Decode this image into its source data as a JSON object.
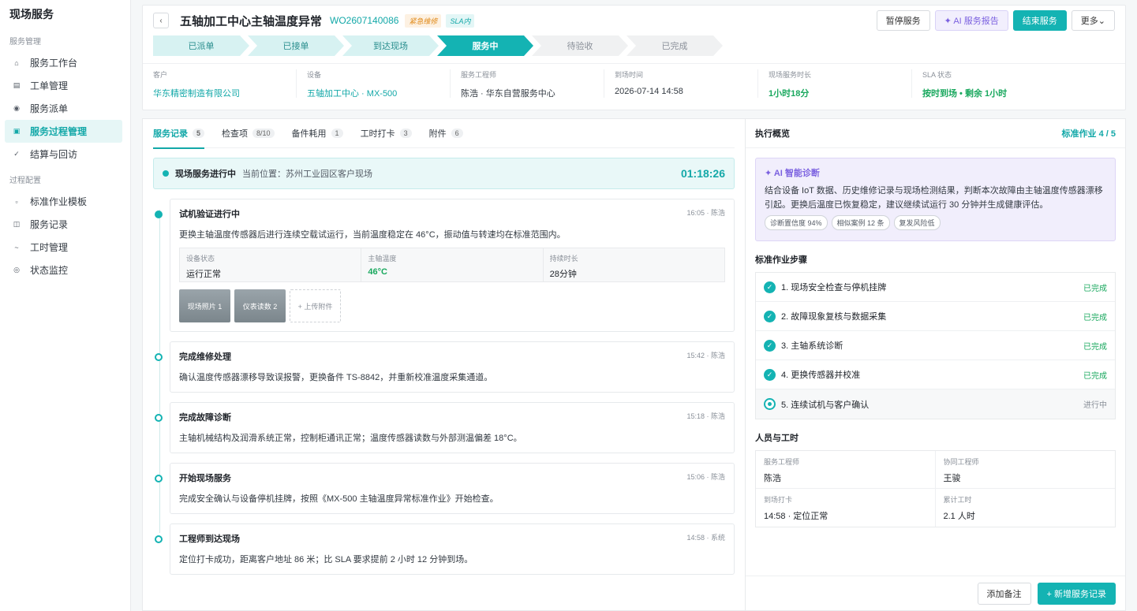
{
  "app_title": "现场服务",
  "sidebar": {
    "group1": "服务管理",
    "items1": [
      {
        "label": "服务工作台",
        "icon": "home-icon",
        "glyph": "⌂"
      },
      {
        "label": "工单管理",
        "icon": "list-icon",
        "glyph": "▤"
      },
      {
        "label": "服务派单",
        "icon": "dispatch-icon",
        "glyph": "◉"
      },
      {
        "label": "服务过程管理",
        "icon": "process-icon",
        "glyph": "▣"
      },
      {
        "label": "结算与回访",
        "icon": "check-icon",
        "glyph": "✓"
      }
    ],
    "group2": "过程配置",
    "items2": [
      {
        "label": "标准作业模板",
        "icon": "template-icon",
        "glyph": "▫"
      },
      {
        "label": "服务记录",
        "icon": "record-icon",
        "glyph": "◫"
      },
      {
        "label": "工时管理",
        "icon": "time-icon",
        "glyph": "~"
      },
      {
        "label": "状态监控",
        "icon": "monitor-icon",
        "glyph": "◎"
      }
    ]
  },
  "header": {
    "back": "‹",
    "title": "五轴加工中心主轴温度异常",
    "wo_no": "WO2607140086",
    "tag_urgent": "紧急维修",
    "tag_sla": "SLA内",
    "btn_pause": "暂停服务",
    "btn_ai": "✦ AI 服务报告",
    "btn_end": "结束服务",
    "btn_more": "更多⌄"
  },
  "steps": [
    "已派单",
    "已接单",
    "到达现场",
    "服务中",
    "待验收",
    "已完成"
  ],
  "infos": [
    {
      "label": "客户",
      "value": "华东精密制造有限公司"
    },
    {
      "label": "设备",
      "value": "五轴加工中心 · MX-500"
    },
    {
      "label": "服务工程师",
      "value": "陈浩 · 华东自营服务中心"
    },
    {
      "label": "到场时间",
      "value": "2026-07-14 14:58"
    },
    {
      "label": "现场服务时长",
      "value": "1小时18分"
    },
    {
      "label": "SLA 状态",
      "value": "按时到场 • 剩余 1小时"
    }
  ],
  "tabs": [
    {
      "label": "服务记录",
      "count": "5"
    },
    {
      "label": "检查项",
      "count": "8/10"
    },
    {
      "label": "备件耗用",
      "count": "1"
    },
    {
      "label": "工时打卡",
      "count": "3"
    },
    {
      "label": "附件",
      "count": "6"
    }
  ],
  "live": {
    "title": "现场服务进行中",
    "location": "当前位置：苏州工业园区客户现场",
    "timer": "01:18:26"
  },
  "timeline": [
    {
      "title": "试机验证进行中",
      "meta": "16:05 · 陈浩",
      "desc": "更换主轴温度传感器后进行连续空载试运行，当前温度稳定在 46°C，振动值与转速均在标准范围内。",
      "grid": [
        {
          "label": "设备状态",
          "value": "运行正常"
        },
        {
          "label": "主轴温度",
          "value": "46°C"
        },
        {
          "label": "持续时长",
          "value": "28分钟"
        }
      ],
      "thumbs": [
        "现场照片 1",
        "仪表读数 2",
        "+ 上传附件"
      ]
    },
    {
      "title": "完成维修处理",
      "meta": "15:42 · 陈浩",
      "desc": "确认温度传感器漂移导致误报警，更换备件 TS-8842，并重新校准温度采集通道。"
    },
    {
      "title": "完成故障诊断",
      "meta": "15:18 · 陈浩",
      "desc": "主轴机械结构及润滑系统正常，控制柜通讯正常；温度传感器读数与外部测温偏差 18°C。"
    },
    {
      "title": "开始现场服务",
      "meta": "15:06 · 陈浩",
      "desc": "完成安全确认与设备停机挂牌，按照《MX-500 主轴温度异常标准作业》开始检查。"
    },
    {
      "title": "工程师到达现场",
      "meta": "14:58 · 系统",
      "desc": "定位打卡成功，距离客户地址 86 米；比 SLA 要求提前 2 小时 12 分钟到场。"
    }
  ],
  "right": {
    "title": "执行概览",
    "progress": "标准作业 4 / 5",
    "ai_title": "✦ AI 智能诊断",
    "ai_desc": "结合设备 IoT 数据、历史维修记录与现场检测结果，判断本次故障由主轴温度传感器漂移引起。更换后温度已恢复稳定，建议继续试运行 30 分钟并生成健康评估。",
    "chips": [
      "诊断置信度 94%",
      "相似案例 12 条",
      "复发风险低"
    ],
    "steps_title": "标准作业步骤",
    "steps": [
      {
        "label": "1. 现场安全检查与停机挂牌",
        "status": "已完成"
      },
      {
        "label": "2. 故障现象复核与数据采集",
        "status": "已完成"
      },
      {
        "label": "3. 主轴系统诊断",
        "status": "已完成"
      },
      {
        "label": "4. 更换传感器并校准",
        "status": "已完成"
      },
      {
        "label": "5. 连续试机与客户确认",
        "status": "进行中"
      }
    ],
    "people_title": "人员与工时",
    "people": [
      {
        "label": "服务工程师",
        "value": "陈浩"
      },
      {
        "label": "协同工程师",
        "value": "王骏"
      },
      {
        "label": "到场打卡",
        "value": "14:58 · 定位正常"
      },
      {
        "label": "累计工时",
        "value": "2.1 人时"
      }
    ],
    "btn_note": "添加备注",
    "btn_add": "+ 新增服务记录"
  }
}
